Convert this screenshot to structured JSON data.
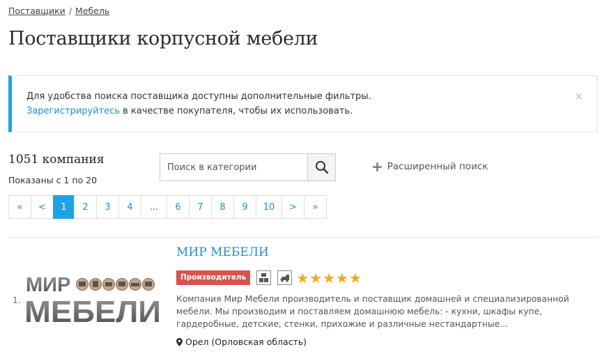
{
  "breadcrumb": {
    "items": [
      "Поставщики",
      "Мебель"
    ],
    "separator": "/"
  },
  "page_title": "Поставщики корпусной мебели",
  "notice": {
    "line1": "Для удобства поиска поставщика доступны дополнительные фильтры.",
    "link": "Зарегистрируйтесь",
    "line2_rest": " в качестве покупателя, чтобы их использовать.",
    "close": "×",
    "accent_color": "#1fa3e0"
  },
  "results": {
    "count": "1051 компания",
    "shown": "Показаны с 1 по 20"
  },
  "search": {
    "placeholder": "Поиск в категории",
    "button_icon": "search-icon"
  },
  "advanced_search": {
    "icon": "plus-icon",
    "label": "Расширенный поиск"
  },
  "pagination": {
    "items": [
      {
        "label": "«",
        "active": false
      },
      {
        "label": "<",
        "active": false
      },
      {
        "label": "1",
        "active": true
      },
      {
        "label": "2",
        "active": false
      },
      {
        "label": "3",
        "active": false
      },
      {
        "label": "4",
        "active": false
      },
      {
        "label": "...",
        "active": false
      },
      {
        "label": "6",
        "active": false
      },
      {
        "label": "7",
        "active": false
      },
      {
        "label": "8",
        "active": false
      },
      {
        "label": "9",
        "active": false
      },
      {
        "label": "10",
        "active": false
      },
      {
        "label": ">",
        "active": false
      },
      {
        "label": "»",
        "active": false
      }
    ]
  },
  "listing": {
    "number": "1.",
    "logo_line1": "МИР",
    "logo_line2": "МЕБЕЛИ",
    "name": "МИР МЕБЕЛИ",
    "badge": "Производитель",
    "icons": [
      "warehouse-icon",
      "truck-icon"
    ],
    "rating": 5,
    "description": "Компания Мир Мебели производитель и поставщик домашней и специализированной мебели. Мы производим и поставляем домашнюю мебель: - кухни, шкафы купе, гардеробные, детские, стенки, прихожие и различные нестандартные...",
    "location": "Орел (Орловская область)"
  },
  "colors": {
    "link": "#1a8fd8",
    "active_page": "#1fa3e0",
    "badge": "#d9534f",
    "star": "#f4a81a"
  }
}
